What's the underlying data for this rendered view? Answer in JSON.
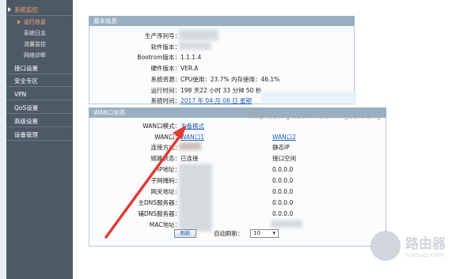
{
  "sidebar": {
    "items": [
      {
        "label": "系统监控"
      },
      {
        "label": "接口设置"
      },
      {
        "label": "安全专区"
      },
      {
        "label": "VPN"
      },
      {
        "label": "QoS设置"
      },
      {
        "label": "高级设置"
      },
      {
        "label": "设备管理"
      }
    ],
    "subs": [
      {
        "label": "运行信息"
      },
      {
        "label": "系统日志"
      },
      {
        "label": "流量监控"
      },
      {
        "label": "网络诊断"
      }
    ]
  },
  "basic": {
    "heading": "基本信息",
    "rows": [
      {
        "label": "生产序列号：",
        "value": ""
      },
      {
        "label": "软件版本：",
        "value": ""
      },
      {
        "label": "Bootrom版本：",
        "value": "1.1.1.4"
      },
      {
        "label": "硬件版本：",
        "value": "VER.A"
      },
      {
        "label": "系统资源：",
        "value": "CPU使用：23.7%   内存使用：46.1%"
      },
      {
        "label": "运行时间：",
        "value": "198 天22 小时 33 分钟 50 秒"
      },
      {
        "label": "系统时间：",
        "value": "2017 年 04 月 06 日 星期"
      }
    ]
  },
  "wan": {
    "heading": "WAN口状态",
    "mode_label": "WAN口模式：",
    "mode_value": "主备模式",
    "port_label": "WAN口：",
    "port1": "WAN口1",
    "port2": "WAN口2",
    "rows": [
      {
        "label": "连接方式：",
        "v1": "",
        "v2": "静态IP"
      },
      {
        "label": "链路状态：",
        "v1": "已连接",
        "v2": "接口空闲"
      },
      {
        "label": "IP地址：",
        "v1": "",
        "v2": "0.0.0.0"
      },
      {
        "label": "子网掩码：",
        "v1": "",
        "v2": "0.0.0.0"
      },
      {
        "label": "网关地址：",
        "v1": "",
        "v2": "0.0.0.0"
      },
      {
        "label": "主DNS服务器：",
        "v1": "",
        "v2": "0.0.0.0"
      },
      {
        "label": "辅DNS服务器：",
        "v1": "",
        "v2": "0.0.0.0"
      },
      {
        "label": "MAC地址：",
        "v1": "",
        "v2": ""
      }
    ]
  },
  "footer": {
    "refresh_button": "刷新",
    "auto_refresh_label": "自动刷新：",
    "interval_value": "10"
  },
  "watermark": "http://blog.csdn.net/mingzaiwang",
  "logo": {
    "title": "路由器",
    "sub": "luyouqi.com"
  },
  "colors": {
    "sidebar": "#4d5a66",
    "section_head": "#9ab0c0",
    "link": "#1f5db8",
    "arrow": "#e03a32"
  }
}
